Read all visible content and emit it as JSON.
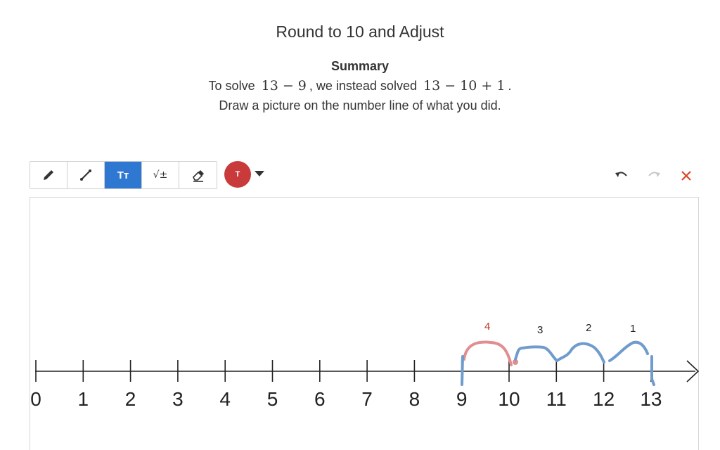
{
  "page": {
    "title": "Round to 10 and Adjust",
    "summary_heading": "Summary",
    "line1_pre": "To solve",
    "line1_math1": "13 − 9",
    "line1_mid": ", we instead solved",
    "line1_math2": "13 − 10 + 1",
    "line1_post": ".",
    "line2": "Draw a picture on the number line of what you did."
  },
  "toolbar": {
    "tools": [
      {
        "name": "pencil-icon",
        "active": false
      },
      {
        "name": "line-icon",
        "active": false
      },
      {
        "name": "text-icon",
        "label": "Tт",
        "active": true
      },
      {
        "name": "math-icon",
        "label": "√±",
        "active": false
      },
      {
        "name": "eraser-icon",
        "active": false
      }
    ],
    "color_button_label": "T",
    "color": "#c93a3a",
    "active_color": "#2e78d2"
  },
  "actions": {
    "undo": "undo-icon",
    "redo": "redo-icon",
    "close": "close-icon",
    "close_color": "#d9482b"
  },
  "number_line": {
    "ticks": [
      "0",
      "1",
      "2",
      "3",
      "4",
      "5",
      "6",
      "7",
      "8",
      "9",
      "10",
      "11",
      "12",
      "13"
    ],
    "annotations": [
      {
        "text": "4",
        "color": "#c0392b"
      },
      {
        "text": "3",
        "color": "#222222"
      },
      {
        "text": "2",
        "color": "#222222"
      },
      {
        "text": "1",
        "color": "#222222"
      }
    ],
    "stroke_colors": {
      "blue": "#6f9ccc",
      "red": "#e08e8e"
    }
  }
}
